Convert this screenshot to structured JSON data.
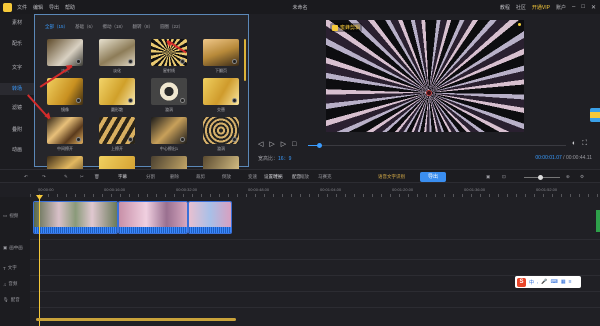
{
  "titlebar": {
    "menu": [
      "文件",
      "编辑",
      "导出",
      "帮助"
    ],
    "title": "未命名",
    "right": [
      "教程",
      "社区",
      "开通VIP",
      "账户"
    ],
    "vip_label": "开通VIP"
  },
  "leftnav": {
    "items": [
      "素材",
      "配乐",
      "文字",
      "转场",
      "滤镜",
      "叠附",
      "动画"
    ],
    "active": "转场"
  },
  "panel": {
    "tabs": [
      "全部（15）",
      "基础（6）",
      "擦动（18）",
      "翻转（8）",
      "圆圈（22）"
    ],
    "thumbs": [
      {
        "label": "淡入",
        "cls": "t1"
      },
      {
        "label": "淡化",
        "cls": "t2"
      },
      {
        "label": "星射线",
        "cls": "t3"
      },
      {
        "label": "下翻页",
        "cls": "t4"
      },
      {
        "label": "镜像",
        "cls": "t5"
      },
      {
        "label": "圆形散",
        "cls": "t6"
      },
      {
        "label": "漩涡",
        "cls": "t7"
      },
      {
        "label": "交替",
        "cls": "t8"
      },
      {
        "label": "中间擦开",
        "cls": "t9"
      },
      {
        "label": "上擦开",
        "cls": "t10"
      },
      {
        "label": "中心擦出1",
        "cls": "t11"
      },
      {
        "label": "漩涡",
        "cls": "t12"
      },
      {
        "label": "",
        "cls": "t13"
      },
      {
        "label": "",
        "cls": "t14"
      },
      {
        "label": "",
        "cls": "t15"
      },
      {
        "label": "",
        "cls": "t16"
      }
    ]
  },
  "preview": {
    "watermark": "蜜蜂剪辑",
    "ratio_label": "宽高比：",
    "ratio_value": "16：9",
    "time_current": "00:00:01.07",
    "time_total": "/ 00:00:44.11"
  },
  "toolbar": {
    "tools": [
      "分割",
      "删除",
      "裁剪",
      "倒放",
      "变速",
      "定格",
      "缩放",
      "设置时长",
      "配音",
      "马赛克",
      "识别文字"
    ],
    "highlight": "字幕",
    "gold": "语音文字识别",
    "export_label": "导出"
  },
  "ruler": {
    "ticks": [
      "00:00:00",
      "00:00:16.00",
      "00:00:32.00",
      "00:00:48.00",
      "00:01:04.00",
      "00:01:20.00",
      "00:01:36.00",
      "00:01:52.00"
    ]
  },
  "tracks": [
    "视频",
    "画中画",
    "文字",
    "音频",
    "配音"
  ],
  "ime": {
    "brand": "S",
    "text": "中"
  }
}
